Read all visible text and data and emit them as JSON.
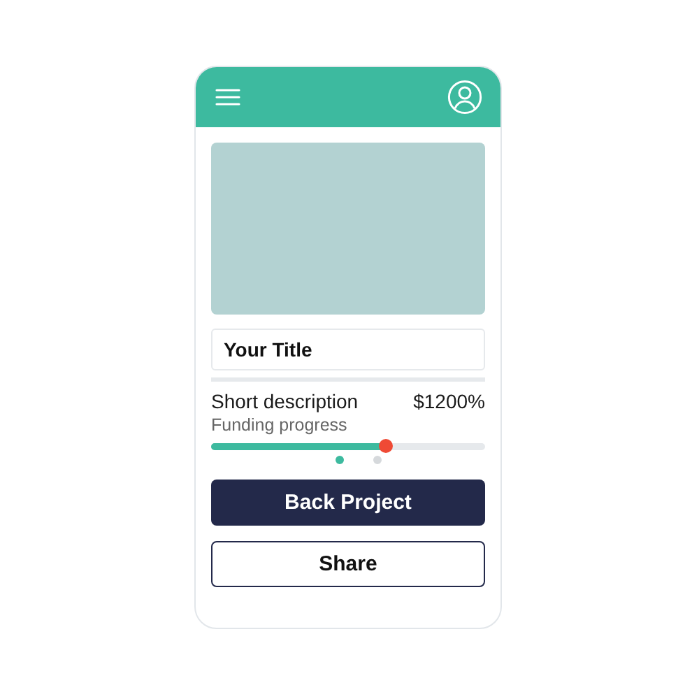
{
  "media": {
    "kind": "placeholder"
  },
  "title_field": {
    "value": "Your Title"
  },
  "description": "Short description",
  "amount": "$1200%",
  "funding_label": "Funding progress",
  "progress": {
    "level": 0.64
  },
  "pager": [
    {
      "selected": true
    },
    {
      "selected": false
    }
  ],
  "buttons": [
    {
      "label": "Back Project",
      "kind": "primary"
    },
    {
      "label": "Share",
      "kind": "outline"
    }
  ]
}
